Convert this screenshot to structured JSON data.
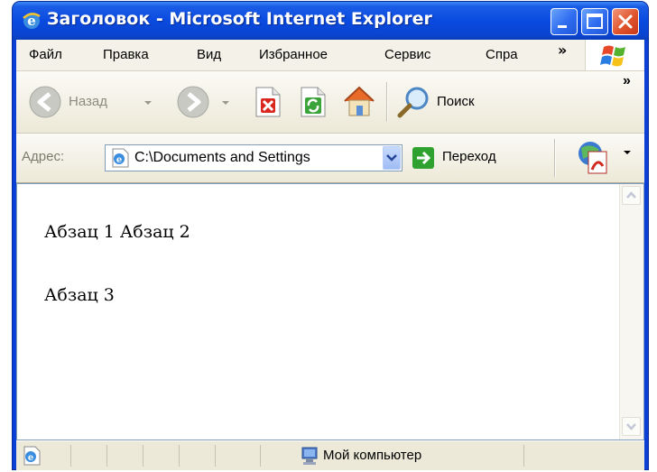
{
  "window": {
    "title": "Заголовок - Microsoft Internet Explorer"
  },
  "menubar": {
    "items": [
      {
        "label": "Файл"
      },
      {
        "label": "Правка"
      },
      {
        "label": "Вид"
      },
      {
        "label": "Избранное"
      },
      {
        "label": "Сервис"
      },
      {
        "label": "Спра"
      }
    ],
    "overflow": "»"
  },
  "toolbar": {
    "back_label": "Назад",
    "search_label": "Поиск",
    "overflow": "»"
  },
  "address": {
    "label": "Адрес:",
    "value": "C:\\Documents and Settings",
    "go_label": "Переход"
  },
  "content": {
    "paragraphs": [
      "Абзац 1 Абзац 2",
      "Абзац 3"
    ]
  },
  "status": {
    "zone_label": "Мой компьютер"
  },
  "colors": {
    "titlebar": "#0a4ae0",
    "chrome": "#ece9d8",
    "close_button": "#e0542c",
    "go_arrow": "#2fa12f",
    "stop_red": "#d9271d"
  },
  "icons": [
    "ie-icon",
    "minimize-icon",
    "maximize-icon",
    "close-icon",
    "windows-logo-icon",
    "back-icon",
    "forward-icon",
    "stop-icon",
    "refresh-icon",
    "home-icon",
    "search-icon",
    "page-ie-icon",
    "chevron-down-icon",
    "go-arrow-icon",
    "pdf-icon",
    "scroll-up-icon",
    "scroll-down-icon",
    "computer-icon"
  ]
}
